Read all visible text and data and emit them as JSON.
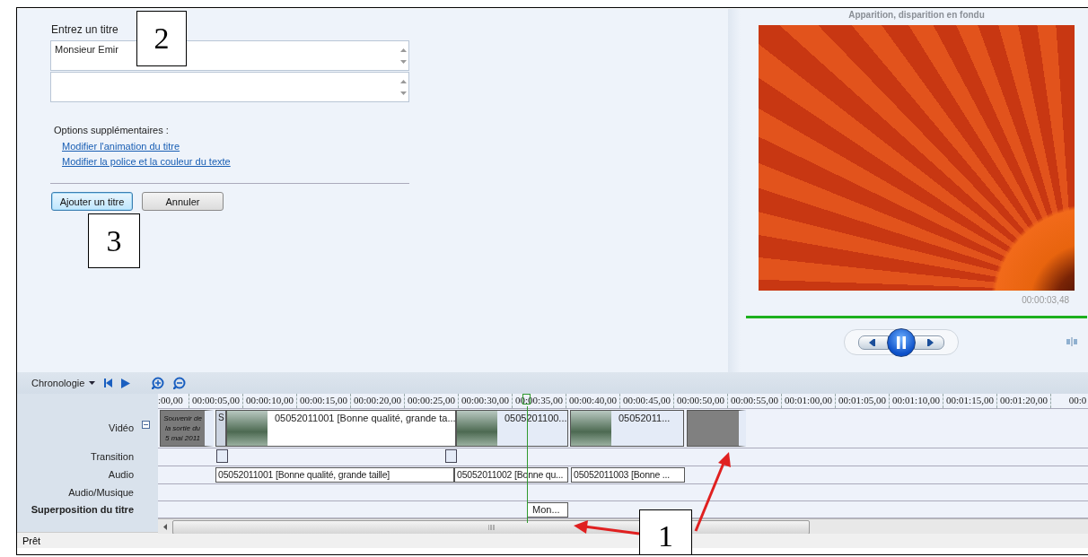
{
  "title_editor": {
    "label": "Entrez un titre",
    "title_field": {
      "value": "Monsieur Emir"
    },
    "options_label": "Options supplémentaires :",
    "links": [
      "Modifier l'animation du titre",
      "Modifier la police et la couleur du texte"
    ],
    "buttons": [
      {
        "label": "Ajouter un titre",
        "focused": true
      },
      {
        "label": "Annuler",
        "focused": false
      }
    ]
  },
  "preview": {
    "caption": "Apparition, disparition en fondu",
    "time": "00:00:03,48",
    "progress": {
      "level": 1
    }
  },
  "timeline": {
    "menu": "Chronologie",
    "ruler": [
      ":00,00",
      "00:00:05,00",
      "00:00:10,00",
      "00:00:15,00",
      "00:00:20,00",
      "00:00:25,00",
      "00:00:30,00",
      "00:00:35,00",
      "00:00:40,00",
      "00:00:45,00",
      "00:00:50,00",
      "00:00:55,00",
      "00:01:00,00",
      "00:01:05,00",
      "00:01:10,00",
      "00:01:15,00",
      "00:01:20,00",
      "00:0"
    ],
    "tracks": [
      {
        "name": "Vidéo",
        "kind": "video",
        "collapsible": true,
        "clips": [
          {
            "kind": "title",
            "lines": [
              "Souvenir de",
              "la sortie du",
              "5 mai 2011"
            ]
          },
          {
            "kind": "short",
            "label": "S"
          },
          {
            "kind": "video",
            "label": "05052011001 [Bonne qualité, grande ta..."
          },
          {
            "kind": "video",
            "label": "0505201100..."
          },
          {
            "kind": "video",
            "label": "05052011..."
          },
          {
            "kind": "end"
          }
        ]
      },
      {
        "name": "Transition",
        "kind": "transition",
        "collapsible": false,
        "clips": [
          {
            "kind": "marker"
          },
          {
            "kind": "marker"
          }
        ]
      },
      {
        "name": "Audio",
        "kind": "audio",
        "collapsible": false,
        "clips": [
          {
            "kind": "audio",
            "label": "05052011001 [Bonne qualité, grande taille]"
          },
          {
            "kind": "audio",
            "label": "05052011002 [Bonne qu..."
          },
          {
            "kind": "audio",
            "label": "05052011003 [Bonne ..."
          }
        ]
      },
      {
        "name": "Audio/Musique",
        "kind": "music",
        "collapsible": false
      },
      {
        "name": "Superposition du titre",
        "kind": "overlay",
        "collapsible": false,
        "clips": [
          {
            "kind": "overlay",
            "label": "Mon..."
          }
        ]
      }
    ]
  },
  "status_bar": {
    "text": "Prêt"
  },
  "callouts": [
    {
      "label": "2"
    },
    {
      "label": "3"
    },
    {
      "label": "1"
    }
  ]
}
